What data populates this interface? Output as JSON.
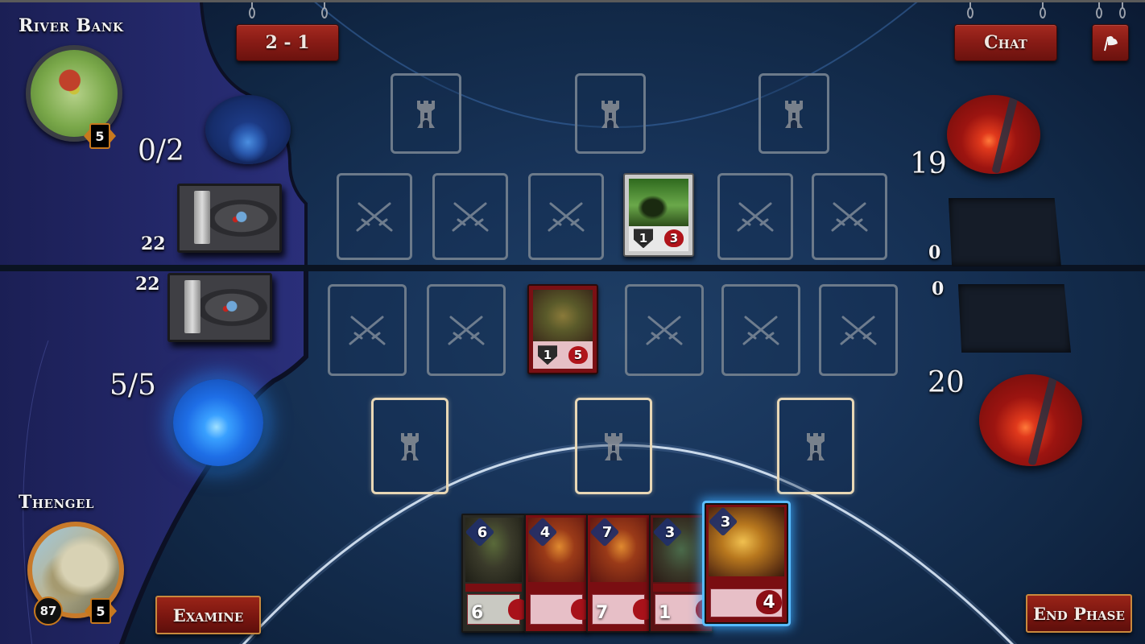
{
  "match": {
    "score": "2 - 1",
    "chat_label": "Chat",
    "surrender_icon": "flag-icon",
    "examine_label": "Examine",
    "end_phase_label": "End Phase"
  },
  "opponent": {
    "name": "River Bank",
    "level": "5",
    "resource": "0/2",
    "deck_count": "22",
    "graveyard_count": "0",
    "life": "19"
  },
  "player": {
    "name": "Thengel",
    "level": "5",
    "rank": "87",
    "resource": "5/5",
    "deck_count": "22",
    "graveyard_count": "0",
    "life": "20"
  },
  "board": {
    "opponent_towers": 3,
    "player_towers": 3,
    "opponent_lane": [
      {
        "empty": true
      },
      {
        "empty": true
      },
      {
        "empty": true
      },
      {
        "empty": false,
        "attack": "1",
        "health": "3",
        "theme": "neutral"
      },
      {
        "empty": true
      },
      {
        "empty": true
      }
    ],
    "player_lane": [
      {
        "empty": true
      },
      {
        "empty": true
      },
      {
        "empty": false,
        "attack": "1",
        "health": "5",
        "theme": "red"
      },
      {
        "empty": true
      },
      {
        "empty": true
      },
      {
        "empty": true
      }
    ]
  },
  "hand": [
    {
      "cost": "6",
      "attack": "6",
      "theme": "dark"
    },
    {
      "cost": "4",
      "attack": "",
      "theme": "red"
    },
    {
      "cost": "7",
      "attack": "7",
      "theme": "red"
    },
    {
      "cost": "3",
      "attack": "1",
      "theme": "dark-red"
    },
    {
      "cost": "3",
      "attack": "",
      "health": "4",
      "theme": "gold",
      "selected": true
    }
  ],
  "colors": {
    "button_red": "#8a1c16",
    "button_border_gold": "#c9893d",
    "selected_glow": "#3aaaff",
    "life_orb": "#9c1410",
    "mana_orb": "#1e6ee6"
  }
}
